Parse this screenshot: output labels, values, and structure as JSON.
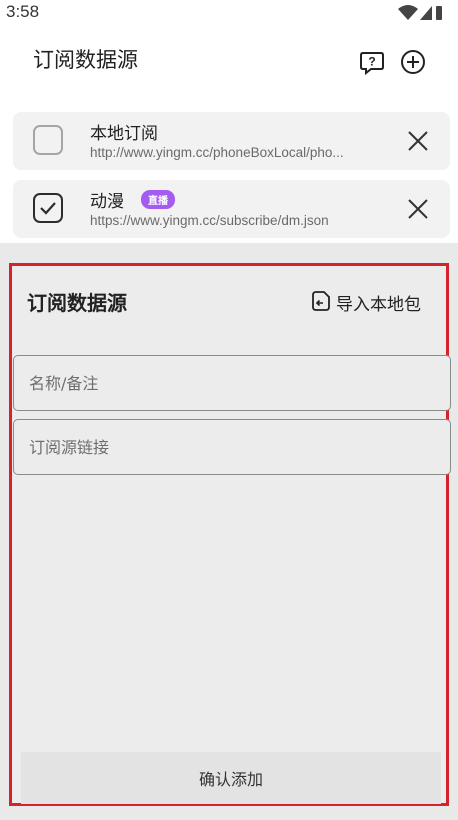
{
  "status_bar": {
    "time": "3:58"
  },
  "header": {
    "title": "订阅数据源",
    "help_icon": "help-bubble-icon",
    "add_icon": "add-circle-icon"
  },
  "subscriptions": [
    {
      "title": "本地订阅",
      "url": "http://www.yingm.cc/phoneBoxLocal/pho...",
      "checked": false,
      "badge": ""
    },
    {
      "title": "动漫",
      "url": "https://www.yingm.cc/subscribe/dm.json",
      "checked": true,
      "badge": "直播"
    }
  ],
  "dialog": {
    "title": "订阅数据源",
    "import_label": "导入本地包",
    "name_placeholder": "名称/备注",
    "url_placeholder": "订阅源链接",
    "confirm_label": "确认添加"
  },
  "colors": {
    "accent_badge": "#a45bf0",
    "highlight_border": "#d4232a"
  }
}
